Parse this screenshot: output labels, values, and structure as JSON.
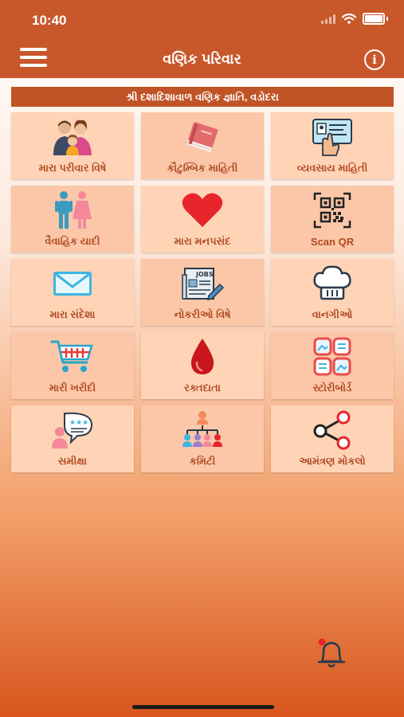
{
  "status_bar": {
    "time": "10:40"
  },
  "app_bar": {
    "title": "વણિક પરિવાર"
  },
  "banner": {
    "text": "શ્રી દશાદિશાવાળ વણિક જ્ઞાતિ, વડોદરા"
  },
  "tiles": [
    {
      "label": "મારા પરીવાર વિષે",
      "icon": "family-icon"
    },
    {
      "label": "કૌટુમ્બિક માહિતી",
      "icon": "book-icon"
    },
    {
      "label": "વ્યવસાય માહિતી",
      "icon": "business-card-icon"
    },
    {
      "label": "વૈવાહિક યાદી",
      "icon": "couple-icon"
    },
    {
      "label": "મારા મનપસંદ",
      "icon": "heart-icon"
    },
    {
      "label": "Scan QR",
      "icon": "qr-code-icon"
    },
    {
      "label": "મારા સંદેશા",
      "icon": "envelope-icon"
    },
    {
      "label": "નોકરીઓ વિષે",
      "icon": "jobs-newspaper-icon"
    },
    {
      "label": "વાનગીઓ",
      "icon": "chef-hat-icon"
    },
    {
      "label": "મારી ખરીદી",
      "icon": "shopping-cart-icon"
    },
    {
      "label": "રક્તદાતા",
      "icon": "blood-drop-icon"
    },
    {
      "label": "સ્ટોરીબોર્ડ",
      "icon": "storyboard-icon"
    },
    {
      "label": "સમીક્ષા",
      "icon": "review-icon"
    },
    {
      "label": "કમિટી",
      "icon": "committee-icon"
    },
    {
      "label": "આમંત્રણ મોકલો",
      "icon": "share-icon"
    }
  ],
  "colors": {
    "app_bar": "#c8572a",
    "tile": "#ffd3b6",
    "label": "#b04a22",
    "accent": "#e53935"
  }
}
